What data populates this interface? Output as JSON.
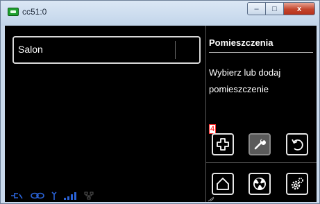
{
  "window": {
    "title": "cc51:0",
    "minimize_glyph": "–",
    "maximize_glyph": "□",
    "close_glyph": "x"
  },
  "rooms": {
    "items": [
      {
        "label": "Salon"
      }
    ]
  },
  "panel": {
    "title": "Pomieszczenia",
    "description": "Wybierz lub dodaj pomieszczenie",
    "badge": "4"
  },
  "icons": {
    "row1": [
      "plus-icon",
      "wrench-icon",
      "back-icon"
    ],
    "row2": [
      "home-icon",
      "fan-icon",
      "settings-icon"
    ],
    "status": [
      "connector-icon",
      "link-icon",
      "antenna-icon",
      "signal-bars-icon",
      "network-icon"
    ]
  },
  "colors": {
    "background": "#000000",
    "text": "#ffffff",
    "status_blue": "#2a62d6",
    "badge_red": "#ff0000"
  }
}
